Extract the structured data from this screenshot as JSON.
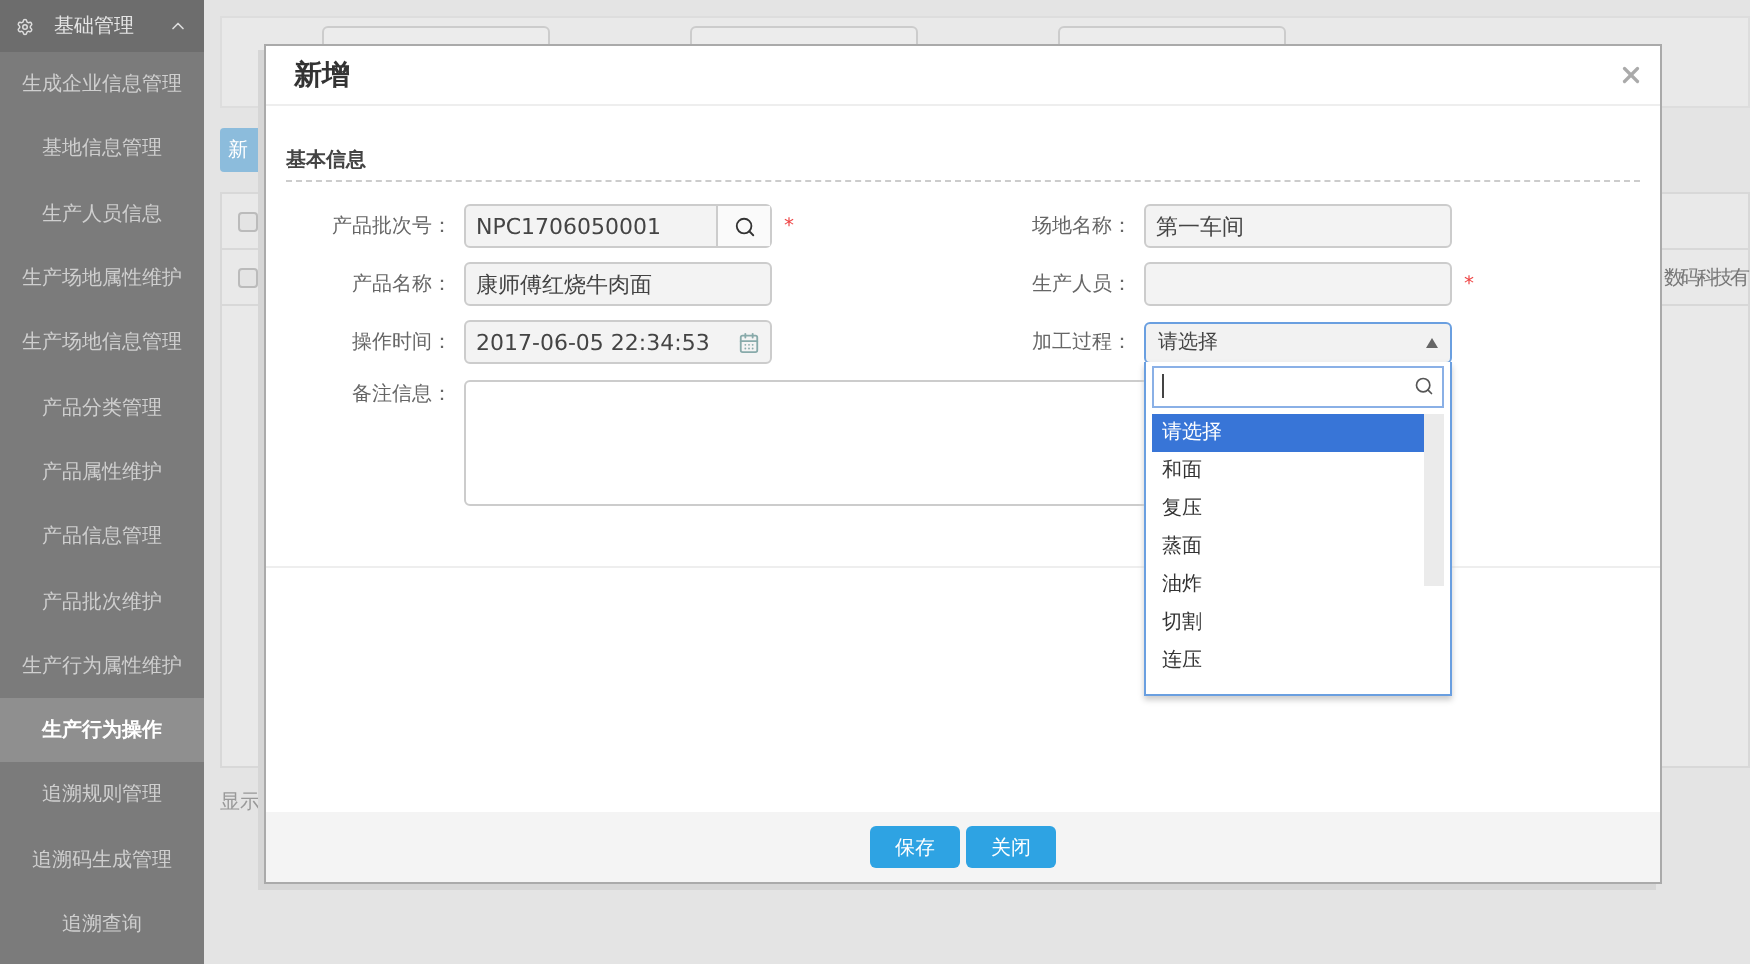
{
  "sidebar": {
    "header": "基础管理",
    "items": [
      {
        "label": "生成企业信息管理",
        "selected": false
      },
      {
        "label": "基地信息管理",
        "selected": false
      },
      {
        "label": "生产人员信息",
        "selected": false
      },
      {
        "label": "生产场地属性维护",
        "selected": false
      },
      {
        "label": "生产场地信息管理",
        "selected": false
      },
      {
        "label": "产品分类管理",
        "selected": false
      },
      {
        "label": "产品属性维护",
        "selected": false
      },
      {
        "label": "产品信息管理",
        "selected": false
      },
      {
        "label": "产品批次维护",
        "selected": false
      },
      {
        "label": "生产行为属性维护",
        "selected": false
      },
      {
        "label": "生产行为操作",
        "selected": true
      },
      {
        "label": "追溯规则管理",
        "selected": false
      },
      {
        "label": "追溯码生成管理",
        "selected": false
      },
      {
        "label": "追溯查询",
        "selected": false
      }
    ]
  },
  "background": {
    "add_button": "新",
    "rows": [
      {
        "checked": false,
        "cell": ""
      },
      {
        "checked": false,
        "cell": "数码科技有"
      }
    ],
    "footer": "显示"
  },
  "dialog": {
    "title": "新增",
    "section": "基本信息",
    "fields": [
      {
        "label": "产品批次号：",
        "value": "NPC1706050001",
        "kind": "search",
        "required": true
      },
      {
        "label": "场地名称：",
        "value": "第一车间",
        "kind": "text",
        "required": false
      },
      {
        "label": "产品名称：",
        "value": "康师傅红烧牛肉面",
        "kind": "text",
        "required": false
      },
      {
        "label": "生产人员：",
        "kind": "text",
        "required": true
      },
      {
        "label": "操作时间：",
        "value": "2017-06-05 22:34:53",
        "kind": "date",
        "required": false
      },
      {
        "label": "加工过程：",
        "value": "请选择",
        "kind": "select",
        "required": false,
        "expanded": true,
        "options": [
          {
            "label": "请选择",
            "selected": true
          },
          {
            "label": "和面",
            "selected": false
          },
          {
            "label": "复压",
            "selected": false
          },
          {
            "label": "蒸面",
            "selected": false
          },
          {
            "label": "油炸",
            "selected": false
          },
          {
            "label": "切割",
            "selected": false
          },
          {
            "label": "连压",
            "selected": false
          }
        ]
      }
    ],
    "remark": {
      "label": "备注信息："
    },
    "required_mark": "*",
    "buttons": [
      "保存",
      "关闭"
    ]
  }
}
